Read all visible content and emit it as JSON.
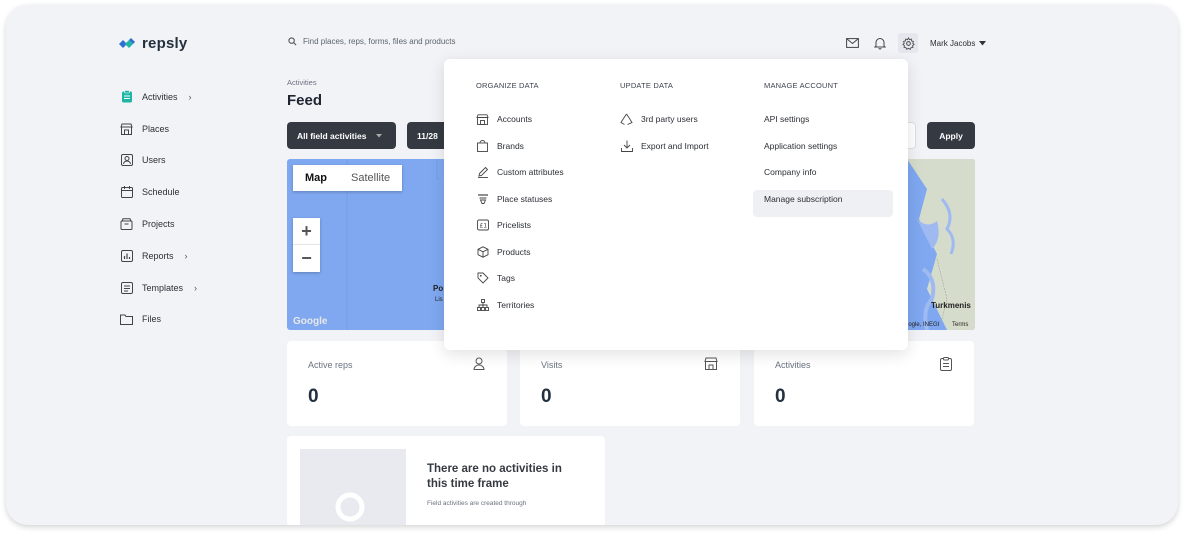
{
  "brand": {
    "name": "repsly"
  },
  "search": {
    "placeholder": "Find places, reps, forms, files and products"
  },
  "topbar": {
    "user_name": "Mark Jacobs",
    "icons": [
      "mail-icon",
      "bell-icon",
      "gear-icon"
    ]
  },
  "sidebar": {
    "items": [
      {
        "label": "Activities",
        "icon": "clipboard-icon",
        "chevron": true
      },
      {
        "label": "Places",
        "icon": "store-icon",
        "chevron": false
      },
      {
        "label": "Users",
        "icon": "user-icon",
        "chevron": false
      },
      {
        "label": "Schedule",
        "icon": "calendar-icon",
        "chevron": false
      },
      {
        "label": "Projects",
        "icon": "box-icon",
        "chevron": false
      },
      {
        "label": "Reports",
        "icon": "chart-icon",
        "chevron": true
      },
      {
        "label": "Templates",
        "icon": "template-icon",
        "chevron": true
      },
      {
        "label": "Files",
        "icon": "folder-icon",
        "chevron": false
      }
    ]
  },
  "page": {
    "breadcrumb": "Activities",
    "title": "Feed"
  },
  "filters": {
    "activity_filter": "All field activities",
    "date_partial": "11/28",
    "apply_label": "Apply"
  },
  "map": {
    "type_map": "Map",
    "type_satellite": "Satellite",
    "zoom_in": "+",
    "zoom_out": "−",
    "google": "Google",
    "label_po": "Po",
    "label_lis": "Lis",
    "label_turkmenis": "Turkmenis",
    "attribution": "oogle, INEGI",
    "terms": "Terms"
  },
  "stats": [
    {
      "label": "Active reps",
      "value": "0",
      "icon": "user-icon"
    },
    {
      "label": "Visits",
      "value": "0",
      "icon": "store-icon"
    },
    {
      "label": "Activities",
      "value": "0",
      "icon": "clipboard-icon"
    }
  ],
  "empty_state": {
    "title": "There are no activities in this time frame",
    "subtitle": "Field activities are created through"
  },
  "settings_menu": {
    "organize": {
      "heading": "ORGANIZE DATA",
      "items": [
        "Accounts",
        "Brands",
        "Custom attributes",
        "Place statuses",
        "Pricelists",
        "Products",
        "Tags",
        "Territories"
      ]
    },
    "update": {
      "heading": "UPDATE DATA",
      "items": [
        "3rd party users",
        "Export and Import"
      ]
    },
    "manage": {
      "heading": "MANAGE ACCOUNT",
      "items": [
        "API settings",
        "Application settings",
        "Company info",
        "Manage subscription"
      ],
      "highlighted": "Manage subscription"
    }
  },
  "colors": {
    "accent_teal": "#1fb5a5",
    "accent_blue": "#2f6fd1",
    "dark": "#353a42",
    "map_water": "#7fa8f1"
  }
}
